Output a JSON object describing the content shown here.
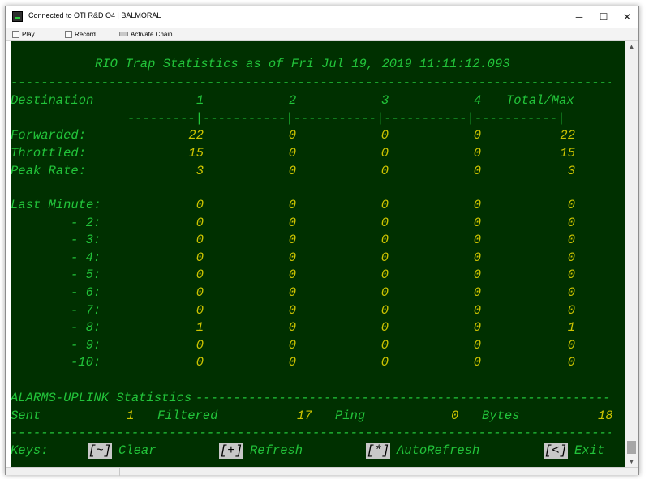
{
  "window": {
    "title": "Connected to OTI R&D O4 | BALMORAL",
    "minimize_glyph": "─",
    "maximize_glyph": "☐",
    "close_glyph": "✕"
  },
  "toolbar": {
    "play_label": "Play...",
    "record_label": "Record",
    "activate_chain_label": "Activate Chain"
  },
  "terminal": {
    "heading": "RIO Trap Statistics as of Fri Jul 19, 2019 11:11:12.093",
    "columns": {
      "label": "Destination",
      "c1": "1",
      "c2": "2",
      "c3": "3",
      "c4": "4",
      "total": "Total/Max"
    },
    "rows": [
      {
        "label": "Forwarded:",
        "v": [
          "22",
          "0",
          "0",
          "0",
          "22"
        ]
      },
      {
        "label": "Throttled:",
        "v": [
          "15",
          "0",
          "0",
          "0",
          "15"
        ]
      },
      {
        "label": "Peak Rate:",
        "v": [
          "3",
          "0",
          "0",
          "0",
          "3"
        ]
      }
    ],
    "minute_rows": [
      {
        "label": "Last Minute:",
        "v": [
          "0",
          "0",
          "0",
          "0",
          "0"
        ]
      },
      {
        "label": "- 2:",
        "v": [
          "0",
          "0",
          "0",
          "0",
          "0"
        ]
      },
      {
        "label": "- 3:",
        "v": [
          "0",
          "0",
          "0",
          "0",
          "0"
        ]
      },
      {
        "label": "- 4:",
        "v": [
          "0",
          "0",
          "0",
          "0",
          "0"
        ]
      },
      {
        "label": "- 5:",
        "v": [
          "0",
          "0",
          "0",
          "0",
          "0"
        ]
      },
      {
        "label": "- 6:",
        "v": [
          "0",
          "0",
          "0",
          "0",
          "0"
        ]
      },
      {
        "label": "- 7:",
        "v": [
          "0",
          "0",
          "0",
          "0",
          "0"
        ]
      },
      {
        "label": "- 8:",
        "v": [
          "1",
          "0",
          "0",
          "0",
          "1"
        ]
      },
      {
        "label": "- 9:",
        "v": [
          "0",
          "0",
          "0",
          "0",
          "0"
        ]
      },
      {
        "label": "-10:",
        "v": [
          "0",
          "0",
          "0",
          "0",
          "0"
        ]
      }
    ],
    "alarms_heading": "ALARMS-UPLINK Statistics",
    "alarms": {
      "sent_label": "Sent",
      "sent_value": "1",
      "filtered_label": "Filtered",
      "filtered_value": "17",
      "ping_label": "Ping",
      "ping_value": "0",
      "bytes_label": "Bytes",
      "bytes_value": "18"
    },
    "keys": {
      "label": "Keys:",
      "clear_key": "[~]",
      "clear_label": "Clear",
      "refresh_key": "[+]",
      "refresh_label": "Refresh",
      "autorefresh_key": "[*]",
      "autorefresh_label": "AutoRefresh",
      "exit_key": "[<]",
      "exit_label": "Exit"
    }
  },
  "colors": {
    "terminal_bg": "#003000",
    "green_text": "#22c43a",
    "yellow_text": "#cdc400"
  }
}
